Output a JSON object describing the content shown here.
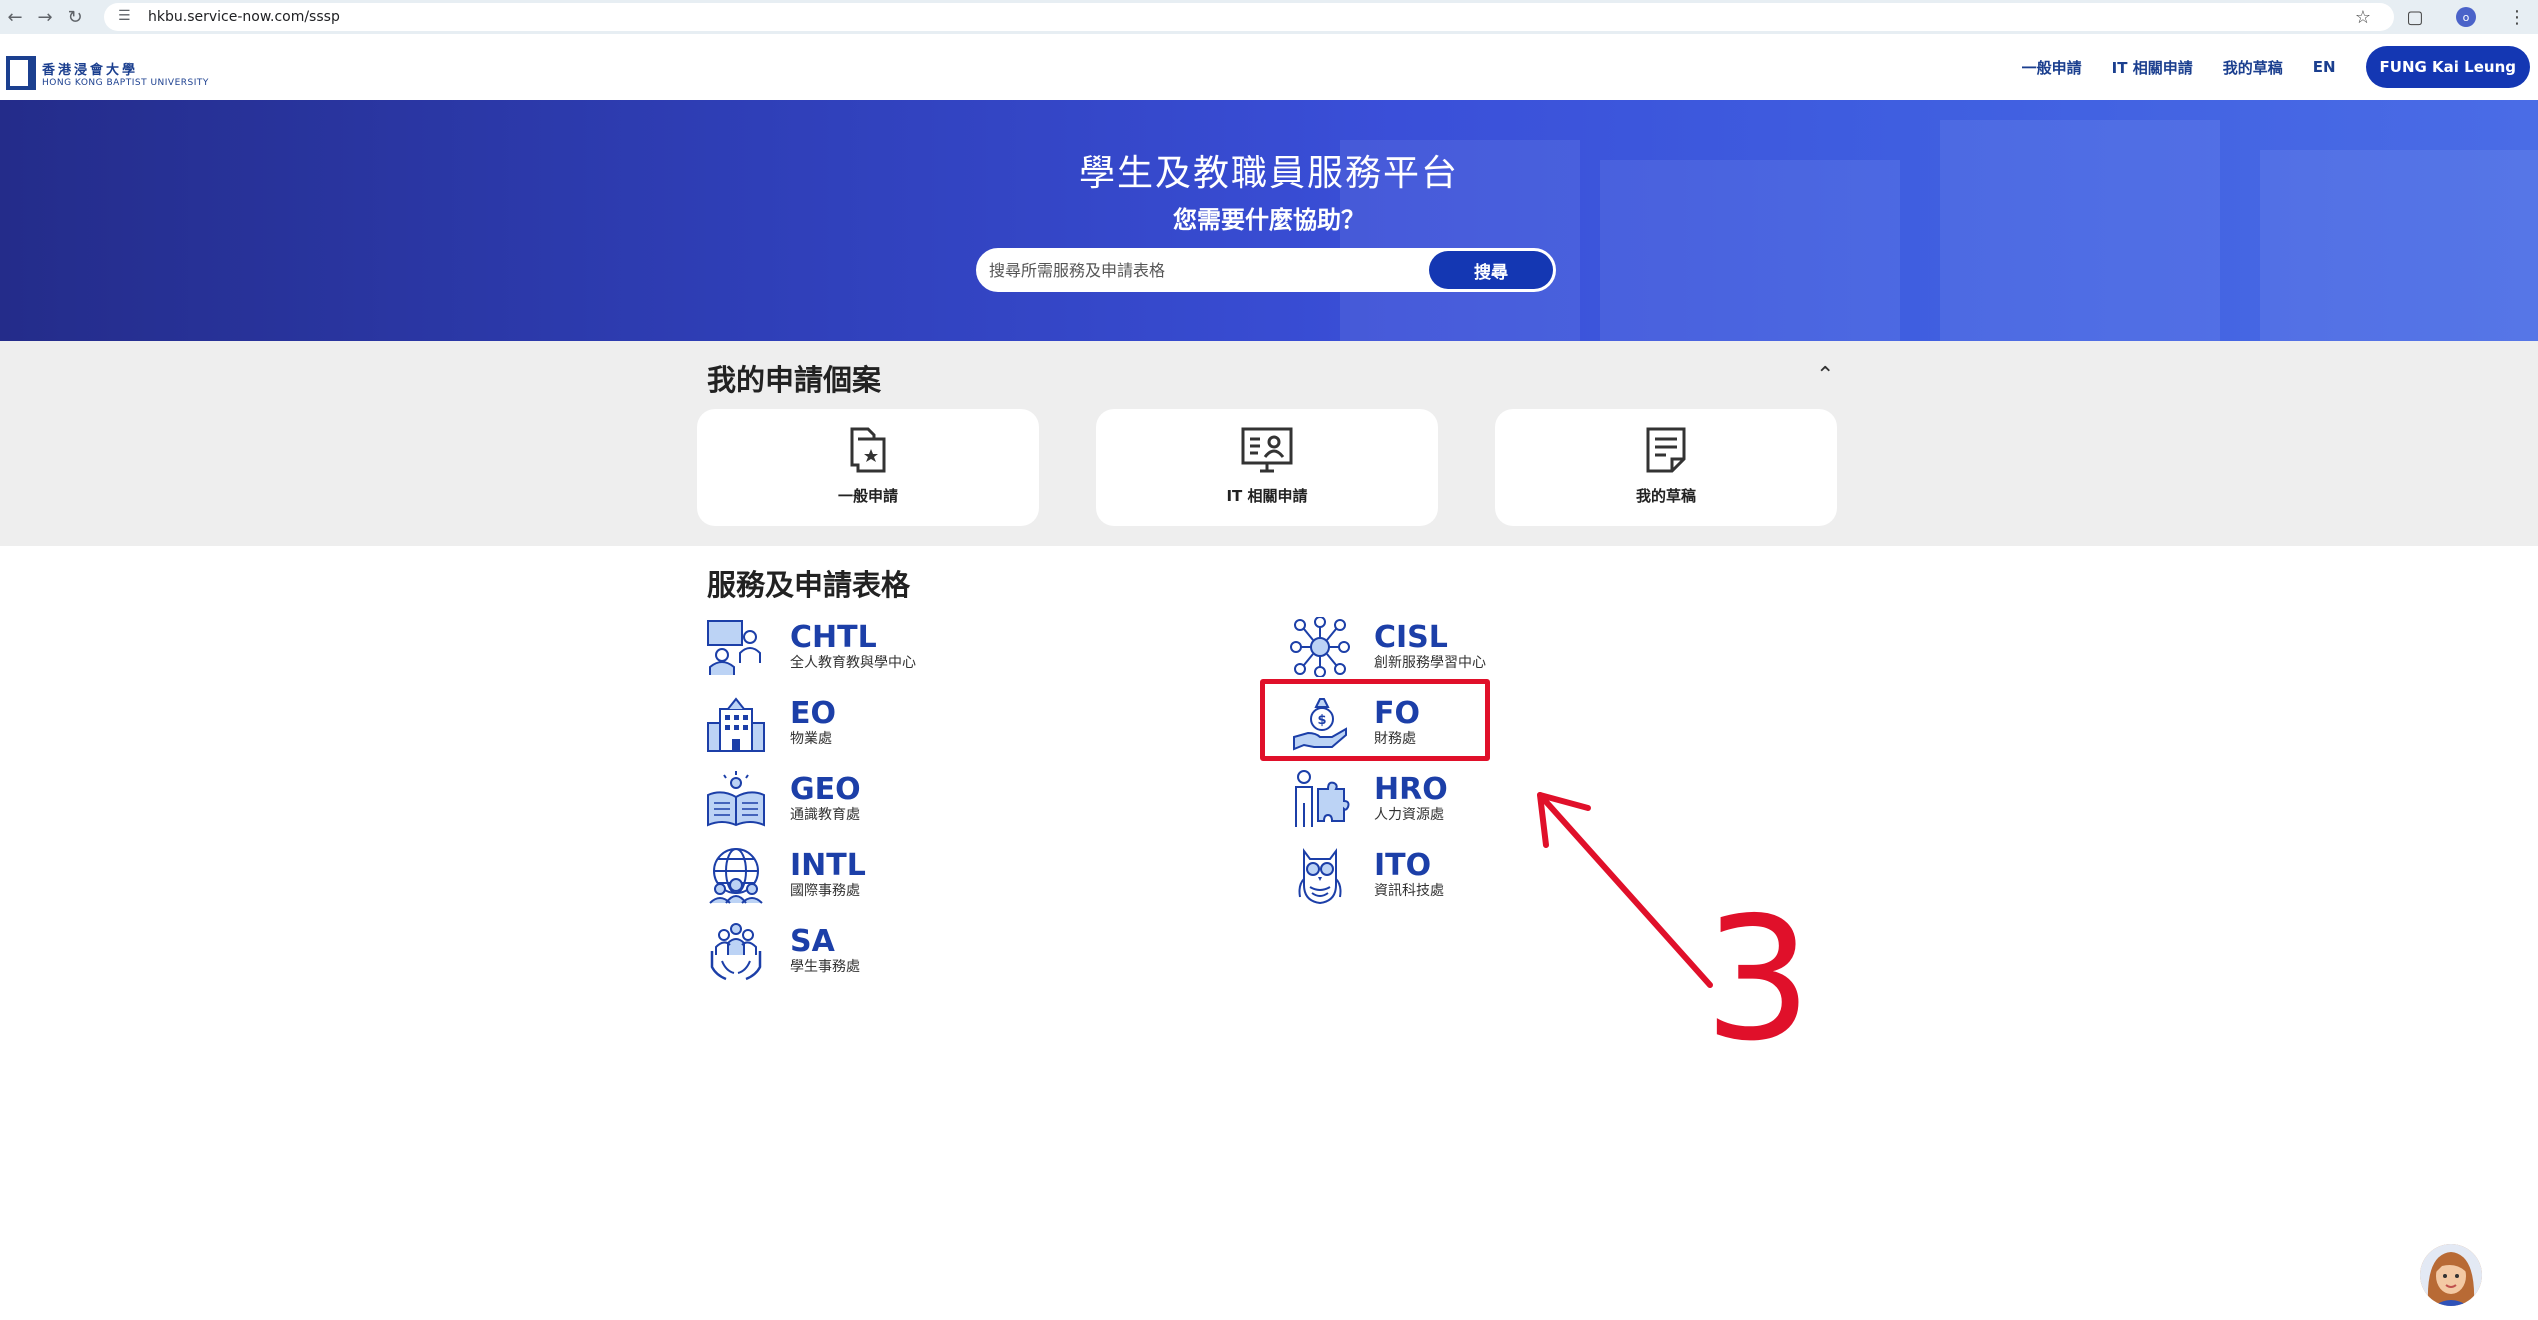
{
  "browser": {
    "url": "hkbu.service-now.com/sssp",
    "profile_initial": "o"
  },
  "header": {
    "logo_cn": "香港浸會大學",
    "logo_en": "HONG KONG BAPTIST UNIVERSITY",
    "nav": [
      "一般申請",
      "IT 相關申請",
      "我的草稿",
      "EN"
    ],
    "user": "FUNG Kai Leung"
  },
  "hero": {
    "title": "學生及教職員服務平台",
    "subtitle": "您需要什麼協助？",
    "search_placeholder": "搜尋所需服務及申請表格",
    "search_button": "搜尋"
  },
  "my_cases": {
    "title": "我的申請個案",
    "cards": [
      {
        "label": "一般申請",
        "icon": "folder-star-icon"
      },
      {
        "label": "IT 相關申請",
        "icon": "monitor-user-icon"
      },
      {
        "label": "我的草稿",
        "icon": "draft-document-icon"
      }
    ]
  },
  "services": {
    "title": "服務及申請表格",
    "items": [
      {
        "code": "CHTL",
        "name": "全人教育教與學中心",
        "icon": "teaching-icon"
      },
      {
        "code": "CISL",
        "name": "創新服務學習中心",
        "icon": "network-idea-icon"
      },
      {
        "code": "EO",
        "name": "物業處",
        "icon": "building-icon"
      },
      {
        "code": "FO",
        "name": "財務處",
        "icon": "money-hand-icon"
      },
      {
        "code": "GEO",
        "name": "通識教育處",
        "icon": "open-book-icon"
      },
      {
        "code": "HRO",
        "name": "人力資源處",
        "icon": "person-puzzle-icon"
      },
      {
        "code": "INTL",
        "name": "國際事務處",
        "icon": "globe-people-icon"
      },
      {
        "code": "ITO",
        "name": "資訊科技處",
        "icon": "owl-icon"
      },
      {
        "code": "SA",
        "name": "學生事務處",
        "icon": "people-hands-icon"
      }
    ]
  },
  "annotation": {
    "label": "3",
    "color": "#e0102a"
  }
}
